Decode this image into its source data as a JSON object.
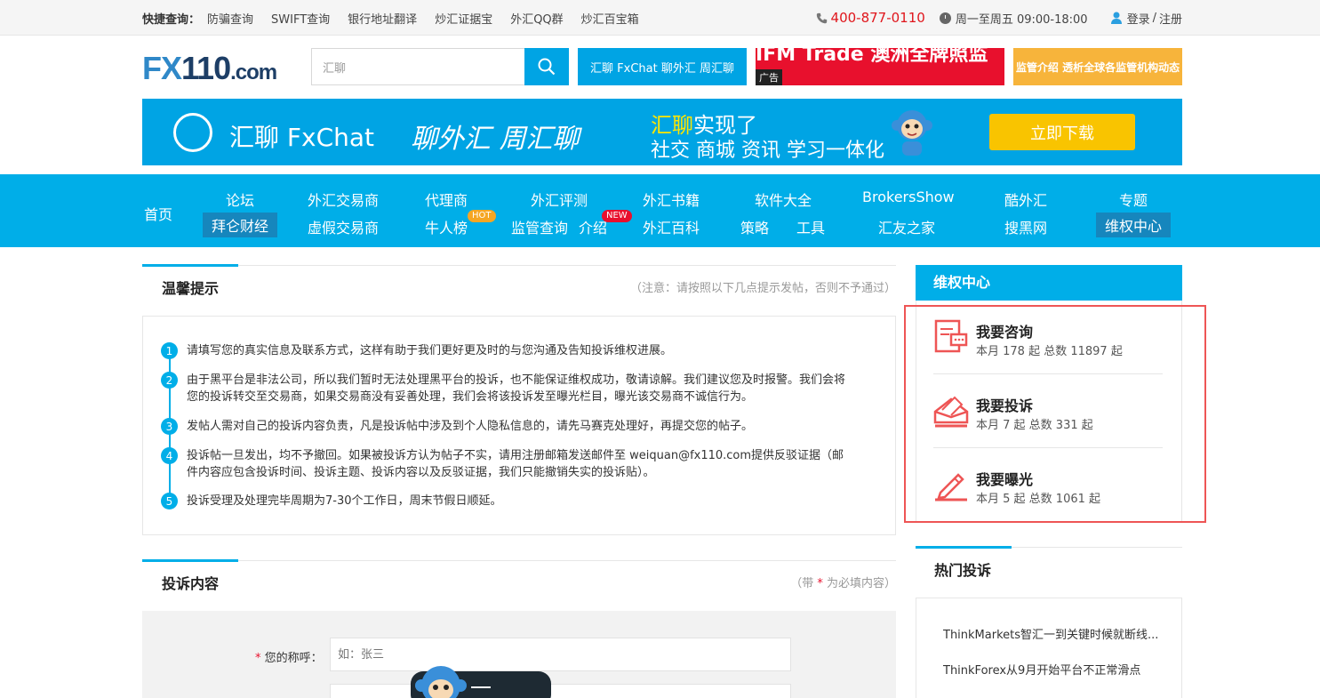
{
  "topbar": {
    "quick_title": "快捷查询：",
    "links": [
      "防骗查询",
      "SWIFT查询",
      "银行地址翻译",
      "炒汇证据宝",
      "外汇QQ群",
      "炒汇百宝箱"
    ],
    "phone": "400-877-0110",
    "hours": "周一至周五 09:00-18:00",
    "login": "登录",
    "login_sep": "/",
    "register": "注册"
  },
  "header": {
    "logo_fx": "FX",
    "logo_num": "110",
    "logo_com": ".com",
    "search_value": "汇聊",
    "ad1_text": "汇聊 FxChat 聊外汇 周汇聊",
    "ad2_text": "IFM Trade 澳洲全牌照监管",
    "ad2_badge": "广告",
    "ad3_text": "监管介绍 透析全球各监管机构动态"
  },
  "banner": {
    "brand": "汇聊 FxChat",
    "slogan": "聊外汇 周汇聊",
    "line1_hl": "汇聊",
    "line1": "实现了",
    "line2": "社交 商城 资讯 学习一体化",
    "button": "立即下载"
  },
  "nav": {
    "home": "首页",
    "row1": [
      "论坛",
      "外汇交易商",
      "代理商",
      "外汇评测",
      "外汇书籍",
      "软件大全",
      "BrokersShow",
      "酷外汇",
      "专题"
    ],
    "row2": [
      "拜仑财经",
      "虚假交易商",
      "牛人榜",
      "监管查询",
      "介绍",
      "外汇百科",
      "策略",
      "工具",
      "汇友之家",
      "搜黑网",
      "维权中心"
    ],
    "hot_badge": "HOT",
    "new_badge": "NEW"
  },
  "tips_section": {
    "title": "温馨提示",
    "note": "（注意：请按照以下几点提示发帖，否则不予通过）",
    "items": [
      {
        "num": "1",
        "text": "请填写您的真实信息及联系方式，这样有助于我们更好更及时的与您沟通及告知投诉维权进展。"
      },
      {
        "num": "2",
        "text": "由于黑平台是非法公司，所以我们暂时无法处理黑平台的投诉，也不能保证维权成功，敬请谅解。我们建议您及时报警。我们会将您的投诉转交至交易商，如果交易商没有妥善处理，我们会将该投诉发至曝光栏目，曝光该交易商不诚信行为。"
      },
      {
        "num": "3",
        "text": "发帖人需对自己的投诉内容负责，凡是投诉帖中涉及到个人隐私信息的，请先马赛克处理好，再提交您的帖子。"
      },
      {
        "num": "4",
        "text": "投诉帖一旦发出，均不予撤回。如果被投诉方认为帖子不实，请用注册邮箱发送邮件至 weiquan@fx110.com提供反驳证据（邮件内容应包含投诉时间、投诉主题、投诉内容以及反驳证据，我们只能撤销失实的投诉贴）。"
      },
      {
        "num": "5",
        "text": "投诉受理及处理完毕周期为7-30个工作日，周末节假日顺延。"
      }
    ]
  },
  "complaint_section": {
    "title": "投诉内容",
    "note_pre": "（带 ",
    "note_star": "*",
    "note_post": " 为必填内容）",
    "name_label": "您的称呼：",
    "name_placeholder": "如：张三"
  },
  "sidebar": {
    "title": "维权中心",
    "items": [
      {
        "title": "我要咨询",
        "stat": "本月 178 起 总数 11897 起",
        "icon": "consult-icon"
      },
      {
        "title": "我要投诉",
        "stat": "本月 7 起 总数 331 起",
        "icon": "complaint-envelope-icon"
      },
      {
        "title": "我要曝光",
        "stat": "本月 5 起 总数 1061 起",
        "icon": "pencil-icon"
      }
    ],
    "hot_title": "热门投诉",
    "hot_items": [
      "ThinkMarkets智汇一到关键时候就断线...",
      "ThinkForex从9月开始平台不正常滑点"
    ]
  },
  "colors": {
    "brand_blue": "#00aee8",
    "accent_red": "#e8102d",
    "highlight_box": "#e55555"
  }
}
